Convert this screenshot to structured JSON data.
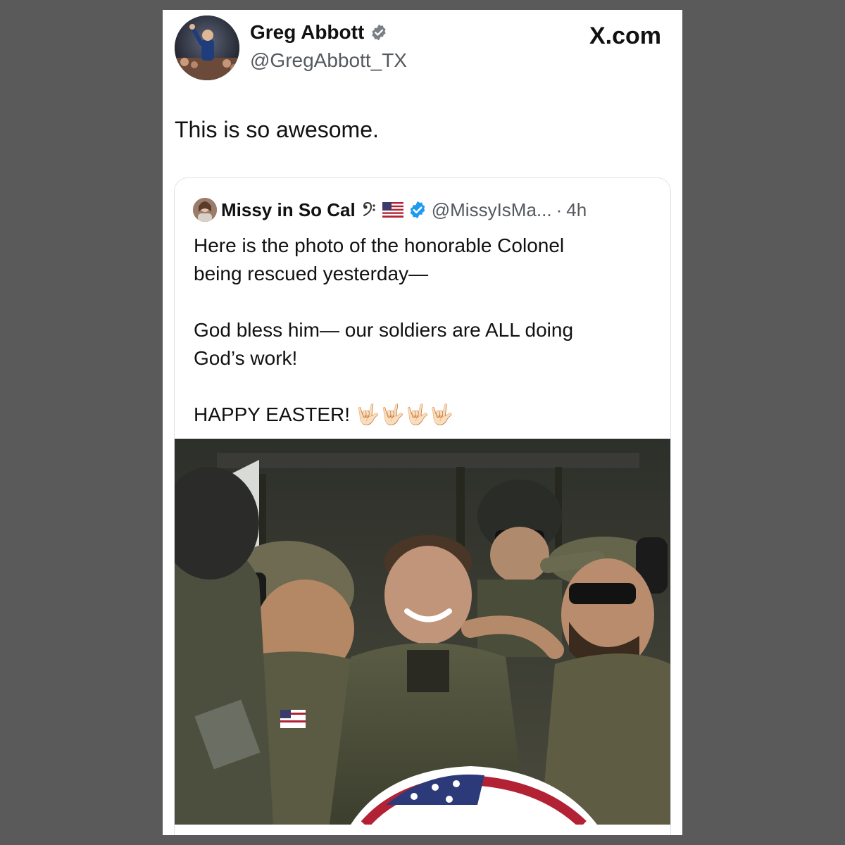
{
  "brand": {
    "site": "X.com"
  },
  "author": {
    "name": "Greg Abbott",
    "handle": "@GregAbbott_TX"
  },
  "tweet": {
    "text": "This is so awesome."
  },
  "quoted": {
    "name": "Missy in So Cal",
    "handle": "@MissyIsMa...",
    "separator": "·",
    "time": "4h",
    "lines": [
      "Here is the photo of the honorable Colonel",
      "being rescued yesterday—",
      "",
      "God bless him— our soldiers are ALL doing",
      "God’s work!",
      "",
      "HAPPY EASTER!"
    ],
    "emoji": "🤟🏻🤟🏻🤟🏻🤟🏻"
  },
  "colors": {
    "verified": "#1d9bf0",
    "text": "#111111",
    "muted": "#54595f",
    "background": "#5a5a5a"
  },
  "icons": [
    "verified-badge-icon",
    "music-clef-icon",
    "us-flag-icon",
    "x-logo-icon"
  ]
}
